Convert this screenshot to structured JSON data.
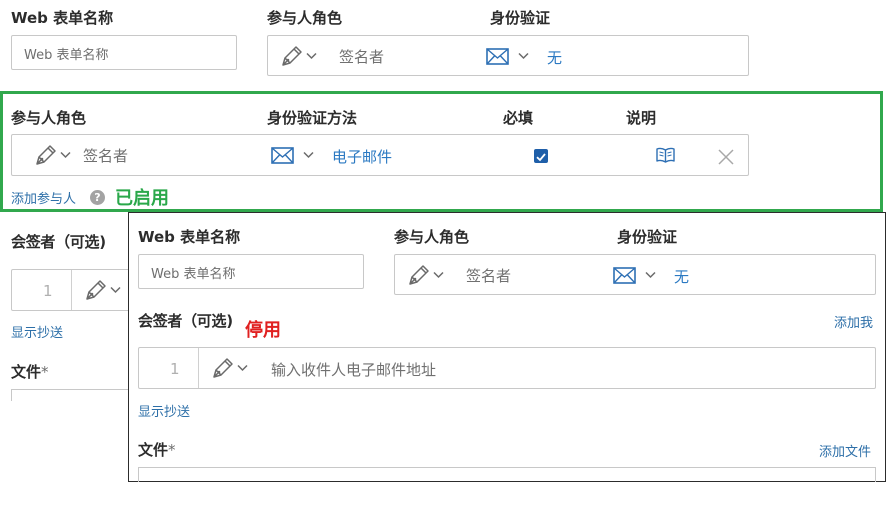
{
  "top": {
    "web_form_name_label": "Web 表单名称",
    "web_form_name_placeholder": "Web 表单名称",
    "participant_role_label": "参与人角色",
    "role_value": "签名者",
    "auth_label": "身份验证",
    "auth_value": "无"
  },
  "enabled_panel": {
    "participant_role_label": "参与人角色",
    "auth_method_label": "身份验证方法",
    "required_label": "必填",
    "notes_label": "说明",
    "role_value": "签名者",
    "auth_value": "电子邮件",
    "required_checked": true,
    "add_participant_link": "添加参与人",
    "help_glyph": "?",
    "state_label": "已启用",
    "state_color": "#2aa84a",
    "frame_color": "#31a84d"
  },
  "background_left": {
    "cc_label": "会签者（可选)",
    "order_number": "1",
    "show_cc_link": "显示抄送",
    "file_label": "文件",
    "required_mark": "*"
  },
  "disabled_panel": {
    "web_form_name_label": "Web 表单名称",
    "web_form_name_placeholder": "Web 表单名称",
    "participant_role_label": "参与人角色",
    "auth_label": "身份验证",
    "role_value": "签名者",
    "auth_value": "无",
    "cc_label": "会签者（可选)",
    "state_label": "停用",
    "state_color": "#e02020",
    "add_me_link": "添加我",
    "order_number": "1",
    "email_placeholder": "输入收件人电子邮件地址",
    "show_cc_link": "显示抄送",
    "file_label": "文件",
    "required_mark": "*",
    "add_file_link": "添加文件"
  },
  "icons": {
    "pen": "pen-icon",
    "mail": "mail-icon",
    "chevron": "chevron-down-icon",
    "book": "book-icon",
    "close": "close-icon",
    "help": "help-icon",
    "checkbox": "checkbox-checked-icon"
  }
}
